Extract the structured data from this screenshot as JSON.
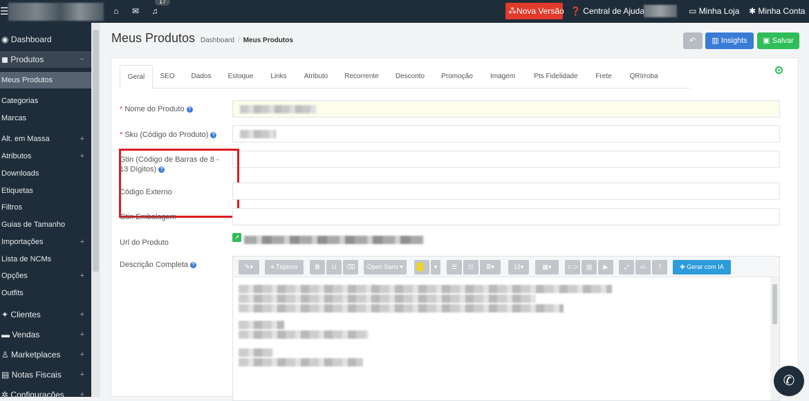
{
  "topbar": {
    "notif_count": "17",
    "nova_versao": "⁂Nova Versão",
    "central_ajuda": "Central de Ajuda",
    "minha_loja": "Minha Loja",
    "minha_conta": "Minha Conta"
  },
  "sidebar": {
    "items": [
      {
        "label": "Dashboard",
        "icon": "dashboard-icon"
      },
      {
        "label": "Produtos",
        "icon": "box-icon",
        "toggle": "−"
      },
      {
        "label": "Meus Produtos"
      },
      {
        "label": "Categorias"
      },
      {
        "label": "Marcas"
      },
      {
        "label": "Alt. em Massa",
        "toggle": "+"
      },
      {
        "label": "Atributos",
        "toggle": "+"
      },
      {
        "label": "Downloads"
      },
      {
        "label": "Etiquetas"
      },
      {
        "label": "Filtros"
      },
      {
        "label": "Guias de Tamanho"
      },
      {
        "label": "Importações",
        "toggle": "+"
      },
      {
        "label": "Lista de NCMs"
      },
      {
        "label": "Opções",
        "toggle": "+"
      },
      {
        "label": "Outfits"
      },
      {
        "label": "Clientes",
        "icon": "users-icon",
        "toggle": "+"
      },
      {
        "label": "Vendas",
        "icon": "cart-icon",
        "toggle": "+"
      },
      {
        "label": "Marketplaces",
        "icon": "marketplace-icon",
        "toggle": "+"
      },
      {
        "label": "Notas Fiscais",
        "icon": "invoice-icon",
        "toggle": "+"
      },
      {
        "label": "Configurações",
        "icon": "config-icon",
        "toggle": "+"
      }
    ]
  },
  "page": {
    "title": "Meus Produtos",
    "breadcrumb_root": "Dashboard",
    "breadcrumb_current": "Meus Produtos",
    "insights_label": "Insights",
    "salvar_label": "Salvar"
  },
  "tabs": [
    "Geral",
    "SEO",
    "Dados",
    "Estoque",
    "Links",
    "Atributo",
    "Recorrente",
    "Desconto",
    "Promoção",
    "Imagem",
    "Pts Fidelidade",
    "Frete",
    "QRIrroba"
  ],
  "form": {
    "nome_label": "Nome do Produto",
    "sku_label": "Sku (Código do Produto)",
    "gtin_label_1": "Gtin (Código de Barras de 8 -",
    "gtin_label_2": "13 Dígitos)",
    "codigo_externo_label": "Código Externo",
    "gtin_embalagem_label": "Gtin Embalagem",
    "url_label": "Url do Produto",
    "descricao_label": "Descrição Completa",
    "required_mark": "*",
    "help_glyph": "?"
  },
  "editor": {
    "topicos": "Tópicos",
    "bold": "B",
    "underline": "U",
    "font_name": "Open Sans",
    "font_size": "13",
    "help": "?",
    "ai_label": "Gerar com IA"
  },
  "colors": {
    "sidebar_bg": "#1f2d3a",
    "accent_blue": "#3a7bd5",
    "save_green": "#2ebd59",
    "nova_red": "#e23a2b",
    "highlight_box": "#e01b22"
  }
}
